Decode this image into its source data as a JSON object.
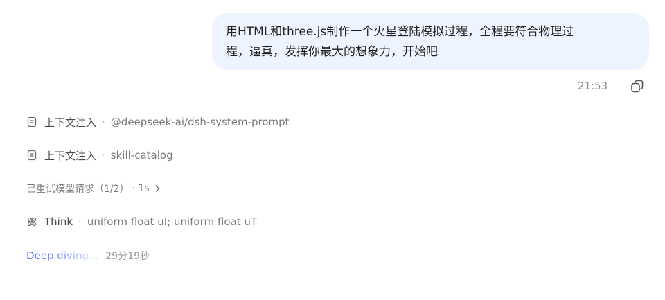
{
  "user_message": {
    "line1": "用HTML和three.js制作一个火星登陆模拟过程，全程要符合物理过",
    "line2": "程，逼真，发挥你最大的想象力，开始吧",
    "timestamp": "21:53",
    "copy_icon": "copy-icon"
  },
  "steps": [
    {
      "icon": "document-icon",
      "label": "上下文注入",
      "separator": "·",
      "detail": "@deepseek-ai/dsh-system-prompt"
    },
    {
      "icon": "document-icon",
      "label": "上下文注入",
      "separator": "·",
      "detail": "skill-catalog"
    },
    {
      "label": "已重试模型请求（1/2）",
      "duration": "· 1s",
      "icon": "chevron-right-icon"
    },
    {
      "icon": "atom-icon",
      "label": "Think",
      "separator": "·",
      "detail": "uniform float uI; uniform float uT"
    }
  ],
  "status": {
    "text": "Deep diving...",
    "elapsed": "29分19秒",
    "accent_color": "#4d6bfe"
  }
}
